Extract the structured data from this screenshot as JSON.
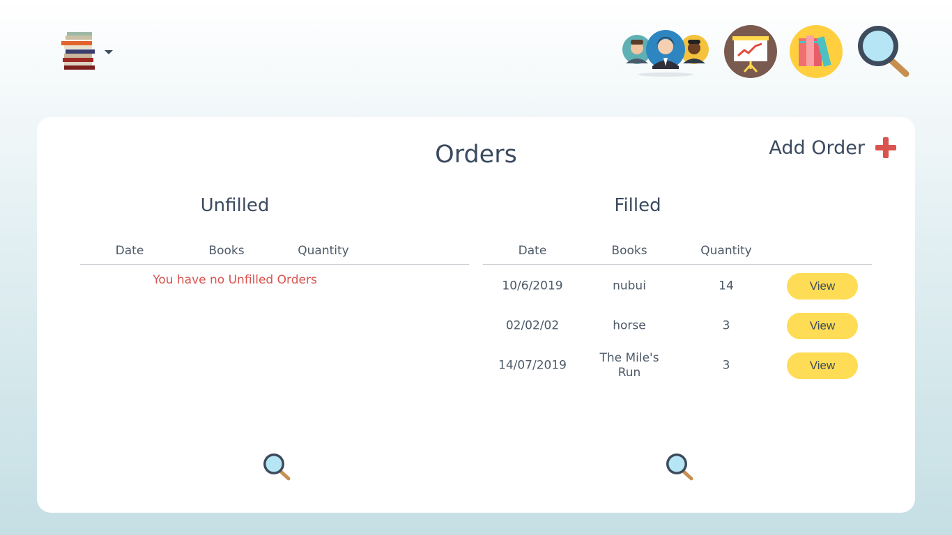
{
  "header": {
    "logo_icon": "books-stack-icon",
    "menu_icon": "caret-down-icon",
    "nav": [
      {
        "name": "users-nav",
        "icon": "users-avatars-icon"
      },
      {
        "name": "reports-nav",
        "icon": "presentation-chart-icon"
      },
      {
        "name": "books-nav",
        "icon": "books-icon"
      },
      {
        "name": "search-nav",
        "icon": "magnifier-icon"
      }
    ]
  },
  "page": {
    "title": "Orders",
    "add_order_label": "Add Order"
  },
  "unfilled": {
    "title": "Unfilled",
    "columns": [
      "Date",
      "Books",
      "Quantity"
    ],
    "empty_message": "You have no Unfilled Orders"
  },
  "filled": {
    "title": "Filled",
    "columns": [
      "Date",
      "Books",
      "Quantity"
    ],
    "rows": [
      {
        "date": "10/6/2019",
        "books": "nubui",
        "quantity": "14",
        "action": "View"
      },
      {
        "date": "02/02/02",
        "books": "horse",
        "quantity": "3",
        "action": "View"
      },
      {
        "date": "14/07/2019",
        "books": "The Mile's Run",
        "quantity": "3",
        "action": "View"
      }
    ]
  },
  "colors": {
    "accent_red": "#d9534f",
    "button_yellow": "#ffdc55",
    "text_dark": "#3b4a5e"
  }
}
